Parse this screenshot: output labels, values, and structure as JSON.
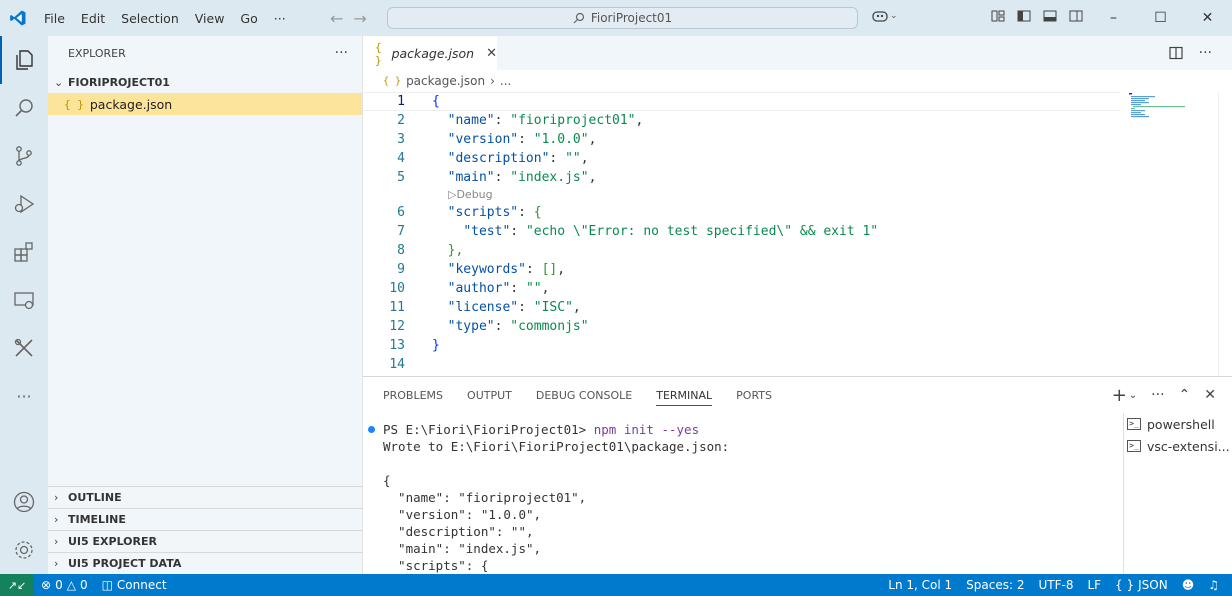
{
  "titlebar": {
    "menu": [
      "File",
      "Edit",
      "Selection",
      "View",
      "Go",
      "···"
    ],
    "search_text": "FioriProject01"
  },
  "sidebar": {
    "title": "EXPLORER",
    "more": "···",
    "folder": "FIORIPROJECT01",
    "file": "package.json",
    "sections": [
      "OUTLINE",
      "TIMELINE",
      "UI5 EXPLORER",
      "UI5 PROJECT DATA"
    ]
  },
  "editor": {
    "tab_label": "package.json",
    "breadcrumb_file": "package.json",
    "breadcrumb_more": "...",
    "codelens": "▷Debug",
    "lines": [
      {
        "n": "1"
      },
      {
        "n": "2"
      },
      {
        "n": "3"
      },
      {
        "n": "4"
      },
      {
        "n": "5"
      },
      {
        "n": "6"
      },
      {
        "n": "7"
      },
      {
        "n": "8"
      },
      {
        "n": "9"
      },
      {
        "n": "10"
      },
      {
        "n": "11"
      },
      {
        "n": "12"
      },
      {
        "n": "13"
      },
      {
        "n": "14"
      }
    ],
    "code": {
      "l1": "{",
      "l2k": "\"name\"",
      "l2v": "\"fioriproject01\"",
      "l3k": "\"version\"",
      "l3v": "\"1.0.0\"",
      "l4k": "\"description\"",
      "l4v": "\"\"",
      "l5k": "\"main\"",
      "l5v": "\"index.js\"",
      "l6k": "\"scripts\"",
      "l7k": "\"test\"",
      "l7v": "\"echo \\\"Error: no test specified\\\" && exit 1\"",
      "l8": "},",
      "l9k": "\"keywords\"",
      "l9v": "[]",
      "l10k": "\"author\"",
      "l10v": "\"\"",
      "l11k": "\"license\"",
      "l11v": "\"ISC\"",
      "l12k": "\"type\"",
      "l12v": "\"commonjs\"",
      "l13": "}"
    }
  },
  "panel": {
    "tabs": [
      "PROBLEMS",
      "OUTPUT",
      "DEBUG CONSOLE",
      "TERMINAL",
      "PORTS"
    ],
    "active_tab": "TERMINAL",
    "terminal": {
      "prompt": "PS E:\\Fiori\\FioriProject01>",
      "command": "npm init --yes",
      "lines": [
        "Wrote to E:\\Fiori\\FioriProject01\\package.json:",
        "",
        "{",
        "  \"name\": \"fioriproject01\",",
        "  \"version\": \"1.0.0\",",
        "  \"description\": \"\",",
        "  \"main\": \"index.js\",",
        "  \"scripts\": {"
      ]
    },
    "terminals": [
      "powershell",
      "vsc-extensi..."
    ]
  },
  "statusbar": {
    "errors": "0",
    "warnings": "0",
    "connect": "Connect",
    "position": "Ln 1, Col 1",
    "spaces": "Spaces: 2",
    "encoding": "UTF-8",
    "eol": "LF",
    "language": "JSON"
  },
  "colors": {
    "accent": "#005fb8",
    "statusbar": "#007acc",
    "remote": "#16825d",
    "selection": "#fce49a"
  }
}
